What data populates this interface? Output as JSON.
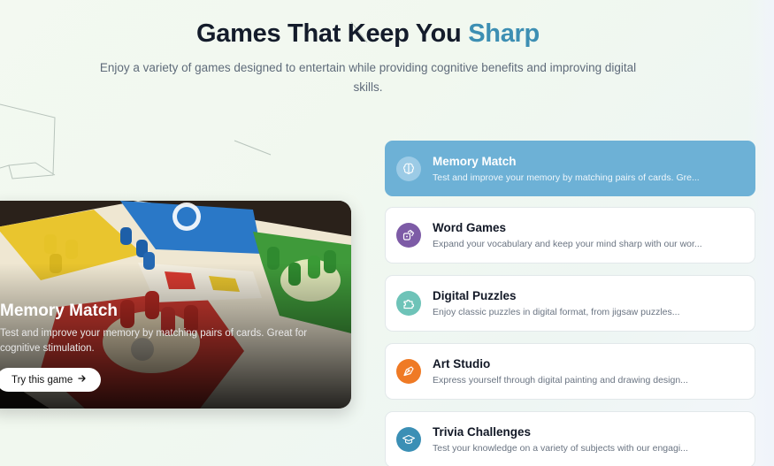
{
  "header": {
    "title_main": "Games That Keep You",
    "title_accent": "Sharp",
    "subtitle": "Enjoy a variety of games designed to entertain while providing cognitive benefits and improving digital skills."
  },
  "featured": {
    "title": "Memory Match",
    "description": "Test and improve your memory by matching pairs of cards. Great for cognitive stimulation.",
    "button_label": "Try this game",
    "button_icon": "arrow-right-icon",
    "image": "board-game-photo"
  },
  "games": [
    {
      "title": "Memory Match",
      "description": "Test and improve your memory by matching pairs of cards. Gre...",
      "icon": "brain-icon",
      "icon_color": "#9ccbe6",
      "active": true
    },
    {
      "title": "Word Games",
      "description": "Expand your vocabulary and keep your mind sharp with our wor...",
      "icon": "dice-icon",
      "icon_color": "#7d5ba6",
      "active": false
    },
    {
      "title": "Digital Puzzles",
      "description": "Enjoy classic puzzles in digital format, from jigsaw puzzles...",
      "icon": "puzzle-icon",
      "icon_color": "#6ec3b8",
      "active": false
    },
    {
      "title": "Art Studio",
      "description": "Express yourself through digital painting and drawing design...",
      "icon": "brush-icon",
      "icon_color": "#ef7a25",
      "active": false
    },
    {
      "title": "Trivia Challenges",
      "description": "Test your knowledge on a variety of subjects with our engagi...",
      "icon": "graduation-cap-icon",
      "icon_color": "#3b8fb5",
      "active": false
    }
  ],
  "colors": {
    "accent": "#3d8fb3",
    "active_item": "#6db1d6"
  }
}
